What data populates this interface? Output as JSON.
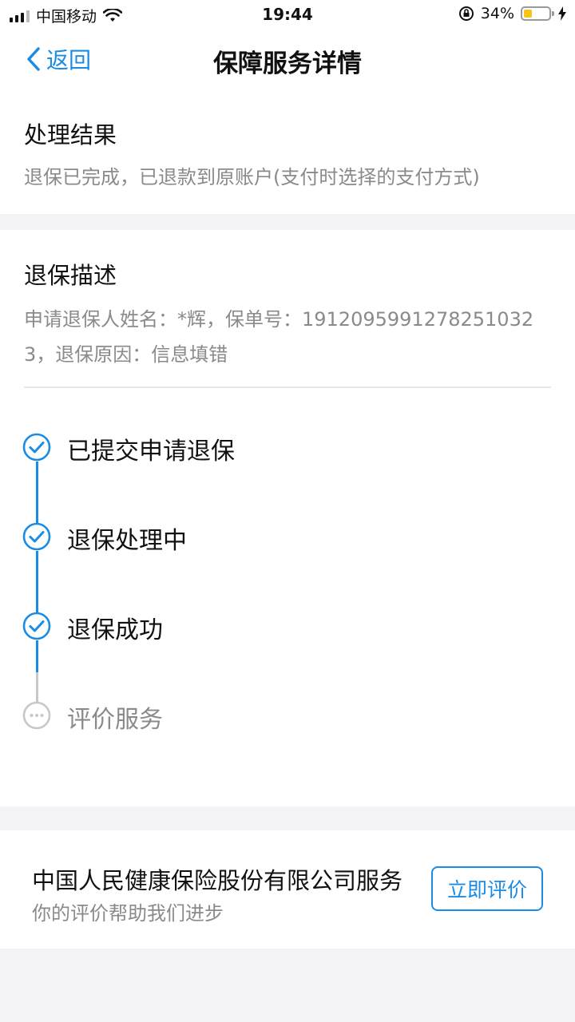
{
  "status_bar": {
    "carrier": "中国移动",
    "time": "19:44",
    "battery": "34%",
    "battery_level": 0.34
  },
  "nav": {
    "back_label": "返回",
    "title": "保障服务详情"
  },
  "result": {
    "title": "处理结果",
    "text": "退保已完成，已退款到原账户(支付时选择的支付方式)"
  },
  "description": {
    "title": "退保描述",
    "text": "申请退保人姓名：*辉，保单号：19120959912782510323，退保原因：信息填错"
  },
  "steps": [
    {
      "label": "已提交申请退保",
      "status": "done"
    },
    {
      "label": "退保处理中",
      "status": "done"
    },
    {
      "label": "退保成功",
      "status": "done"
    },
    {
      "label": "评价服务",
      "status": "pending"
    }
  ],
  "footer": {
    "company": "中国人民健康保险股份有限公司服务",
    "subtitle": "你的评价帮助我们进步",
    "rate_button": "立即评价"
  },
  "colors": {
    "accent": "#1a8ce6",
    "pending": "#c8c8c8",
    "background": "#f3f3f7"
  }
}
